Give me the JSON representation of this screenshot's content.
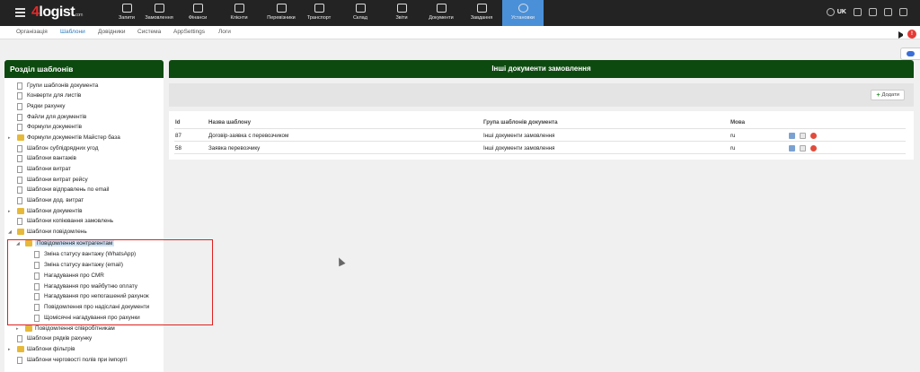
{
  "app": {
    "logo_main": "logist",
    "logo_four": "4",
    "logo_suffix": ".com"
  },
  "nav": [
    {
      "label": "Запити",
      "icon": "requests-icon"
    },
    {
      "label": "Замовлення",
      "icon": "orders-icon"
    },
    {
      "label": "Фінанси",
      "icon": "finance-icon"
    },
    {
      "label": "Клієнти",
      "icon": "clients-icon"
    },
    {
      "label": "Перевізники",
      "icon": "carriers-icon"
    },
    {
      "label": "Транспорт",
      "icon": "transport-icon"
    },
    {
      "label": "Склад",
      "icon": "warehouse-icon"
    },
    {
      "label": "Звіти",
      "icon": "reports-icon"
    },
    {
      "label": "Документи",
      "icon": "documents-icon"
    },
    {
      "label": "Завдання",
      "icon": "tasks-icon"
    },
    {
      "label": "Установки",
      "icon": "settings-gear-icon",
      "active": true
    }
  ],
  "header_right": {
    "lang": "UK"
  },
  "subnav": [
    "Організація",
    "Шаблони",
    "Довідники",
    "Система",
    "AppSettings",
    "Логи"
  ],
  "notifications": {
    "badge": "!"
  },
  "sidebar": {
    "title": "Розділ шаблонів",
    "items": [
      "Групи шаблонів документа",
      "Конверти для листів",
      "Рядки рахунку",
      "Файли для документів",
      "Формули документів",
      "Формули документів Майстер база",
      "Шаблон субпідрядних угод",
      "Шаблони вантажів",
      "Шаблони витрат",
      "Шаблони витрат рейсу",
      "Шаблони відправлень по email",
      "Шаблони дод. витрат",
      "Шаблони документів",
      "Шаблони копіювання замовлень",
      "Шаблони повідомлень",
      "Повідомлення контрагентам",
      "Зміна статусу вантажу (WhatsApp)",
      "Зміна статусу вантажу (email)",
      "Нагадування про CMR",
      "Нагадування про майбутню оплату",
      "Нагадування про непогашений рахунок",
      "Повідомлення про надіслані документи",
      "Щомісячні нагадування про рахунки",
      "Повідомлення співробітникам",
      "Шаблони рядків рахунку",
      "Шаблони фільтрів",
      "Шаблони черговості полів при імпорті"
    ]
  },
  "main": {
    "title": "Інші документи замовлення",
    "add_label": "Додати",
    "columns": {
      "id": "Id",
      "name": "Назва шаблону",
      "group": "Група шаблонів документа",
      "lang": "Мова"
    },
    "rows": [
      {
        "id": "87",
        "name": "Договір-заявка с перевозчиком",
        "group": "Інші документи замовлення",
        "lang": "ru"
      },
      {
        "id": "58",
        "name": "Заявка перевозчику",
        "group": "Інші документи замовлення",
        "lang": "ru"
      }
    ]
  }
}
